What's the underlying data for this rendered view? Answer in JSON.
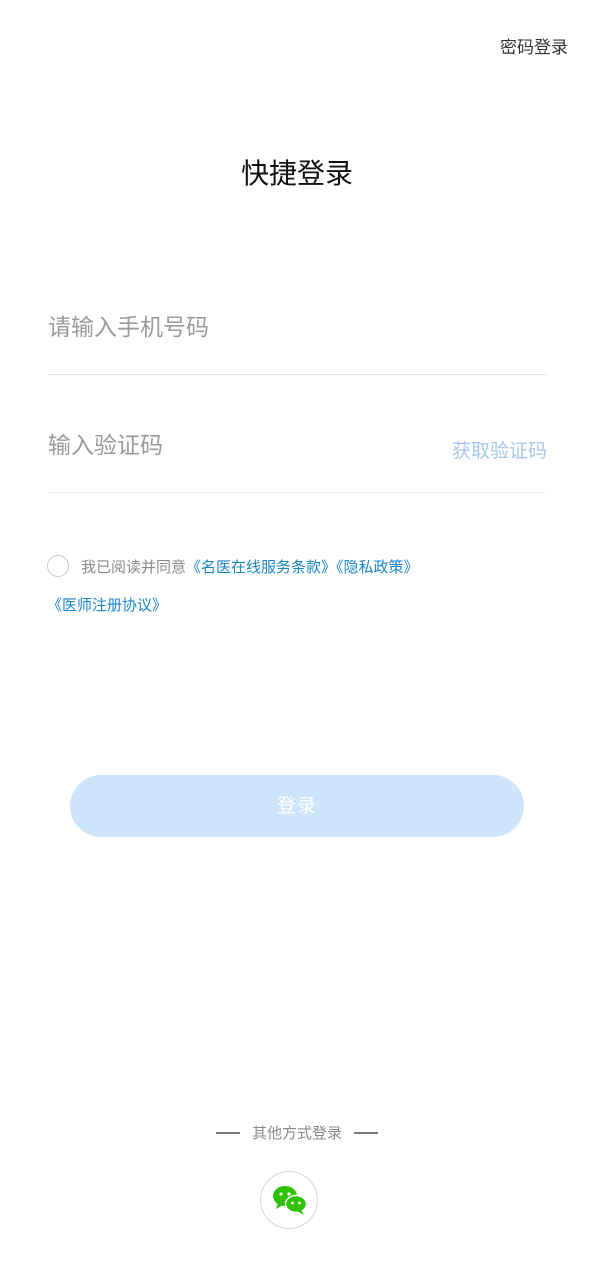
{
  "header": {
    "password_login_label": "密码登录",
    "title": "快捷登录"
  },
  "form": {
    "phone": {
      "placeholder": "请输入手机号码",
      "value": ""
    },
    "code": {
      "placeholder": "输入验证码",
      "value": "",
      "get_code_label": "获取验证码"
    }
  },
  "agreement": {
    "checked": false,
    "prefix": "我已阅读并同意",
    "links": [
      "《名医在线服务条款》",
      "《隐私政策》",
      "《医师注册协议》"
    ]
  },
  "login_button_label": "登录",
  "other_login": {
    "label": "其他方式登录",
    "wechat_icon": "wechat-icon"
  },
  "colors": {
    "accent_link": "#1a86c8",
    "button_disabled": "#cde5fb",
    "get_code_disabled": "#a6c7e9",
    "wechat_green": "#2dc100"
  }
}
